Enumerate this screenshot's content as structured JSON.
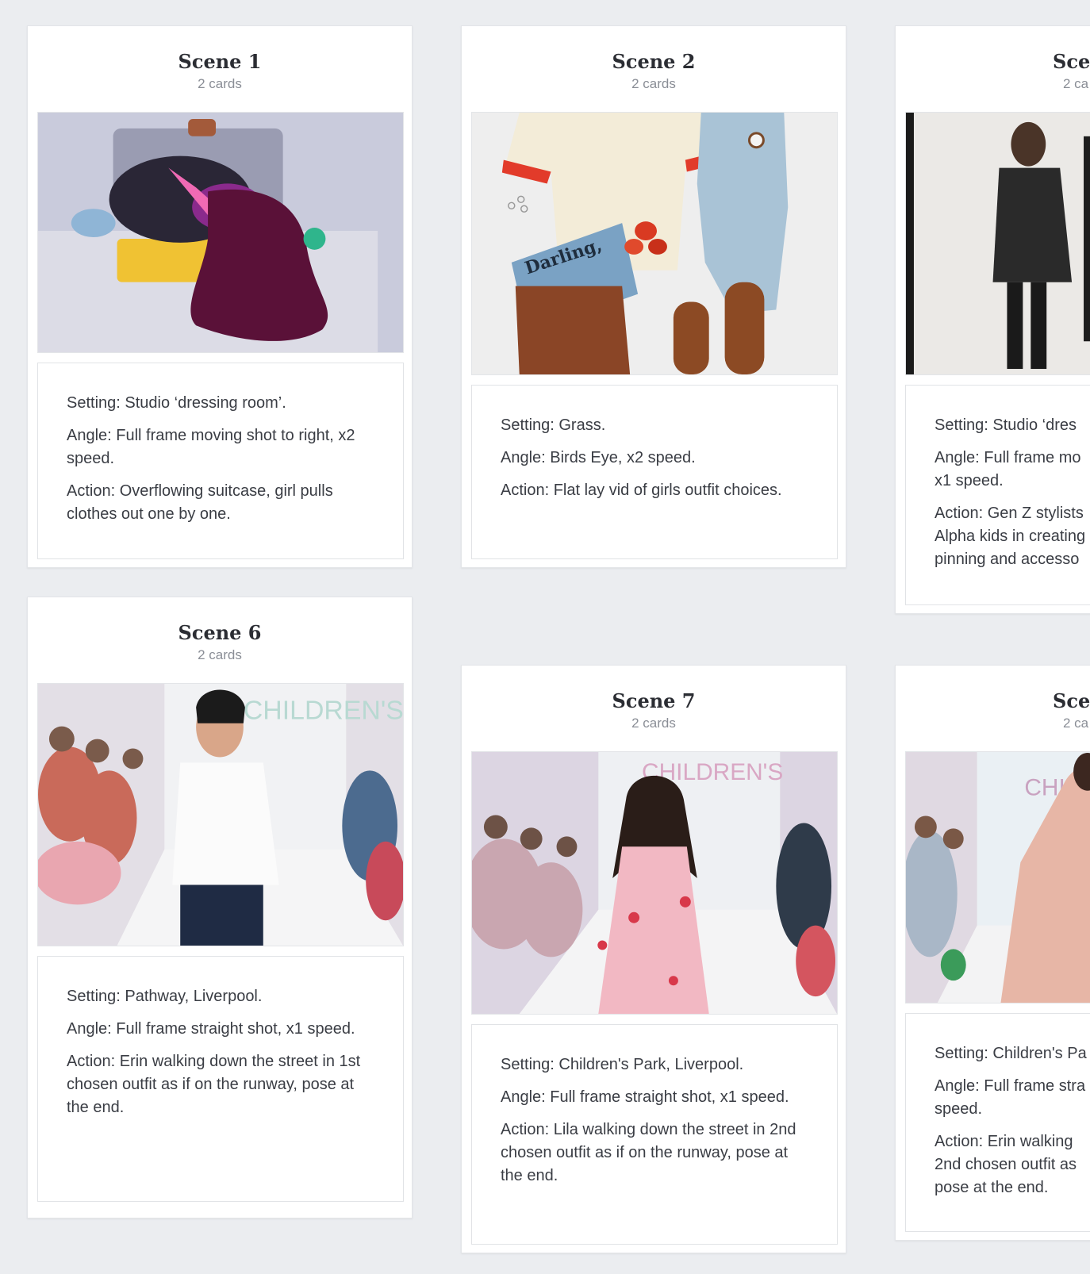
{
  "scenes": [
    {
      "title": "Scene 1",
      "count": "2 cards",
      "image": "suitcase-clothes-photo",
      "setting": "Setting: Studio ‘dressing room’.",
      "angle": "Angle: Full frame moving shot to right, x2 speed.",
      "action": "Action: Overflowing suitcase, girl pulls clothes out one by one."
    },
    {
      "title": "Scene 2",
      "count": "2 cards",
      "image": "flat-lay-outfit-photo",
      "setting": "Setting: Grass.",
      "angle": "Angle: Birds Eye, x2 speed.",
      "action": "Action: Flat lay vid of girls outfit choices."
    },
    {
      "title": "Scen",
      "count": "2 ca",
      "image": "stylist-studio-photo",
      "setting": "Setting: Studio ‘dres",
      "angle": "Angle: Full frame mo\nx1 speed.",
      "action": "Action: Gen Z stylists\nAlpha kids in creating\npinning and accesso"
    },
    {
      "title": "Scene 6",
      "count": "2 cards",
      "image": "runway-girl-white-top-photo",
      "setting": "Setting: Pathway, Liverpool.",
      "angle": "Angle: Full frame straight shot, x1 speed.",
      "action": "Action: Erin walking down the street in 1st chosen outfit as if on the runway, pose at the end."
    },
    {
      "title": "Scene 7",
      "count": "2 cards",
      "image": "runway-girl-pink-dress-photo",
      "setting": "Setting: Children's Park, Liverpool.",
      "angle": "Angle: Full frame straight shot, x1 speed.",
      "action": "Action: Lila walking down the street in 2nd chosen outfit as if on the runway, pose at the end."
    },
    {
      "title": "Scen",
      "count": "2 ca",
      "image": "runway-girl-peach-dress-photo",
      "setting": "Setting: Children's Pa",
      "angle": "Angle: Full frame stra\nspeed.",
      "action": "Action: Erin walking\n2nd chosen outfit as\npose at the end."
    }
  ],
  "image_text": {
    "magazine": "Darling,",
    "banner": "CHILDREN'S"
  },
  "colors": {
    "background": "#ebedf0",
    "panel": "#ffffff",
    "title": "#2b2d33",
    "muted": "#8a8e96",
    "body": "#3a3d44"
  }
}
